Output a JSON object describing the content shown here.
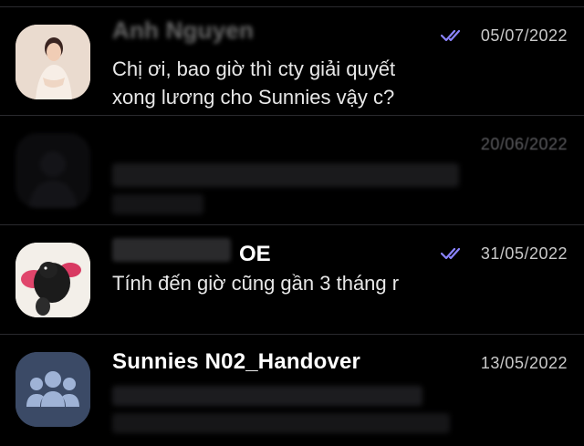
{
  "conversations": [
    {
      "name": "Anh Nguyen",
      "date": "05/07/2022",
      "read": true,
      "message_line1": "Chị ơi, bao giờ thì cty giải quyết",
      "message_line2": "xong lương cho Sunnies vậy c?"
    },
    {
      "name": "",
      "date": "20/06/2022",
      "read": false,
      "message_line1": "",
      "message_line2": ""
    },
    {
      "name_visible": "OE",
      "date": "31/05/2022",
      "read": true,
      "message_line1": "Tính đến giờ cũng gần 3 tháng r"
    },
    {
      "name": "Sunnies N02_Handover",
      "date": "13/05/2022",
      "read": false,
      "message_line1": "",
      "message_line2": ""
    }
  ],
  "colors": {
    "read_check": "#8b84ff",
    "background": "#000000",
    "divider": "#2a2a2e",
    "group_avatar": "#3b4a66"
  },
  "icons": [
    "double-check-icon",
    "group-avatar-icon"
  ]
}
